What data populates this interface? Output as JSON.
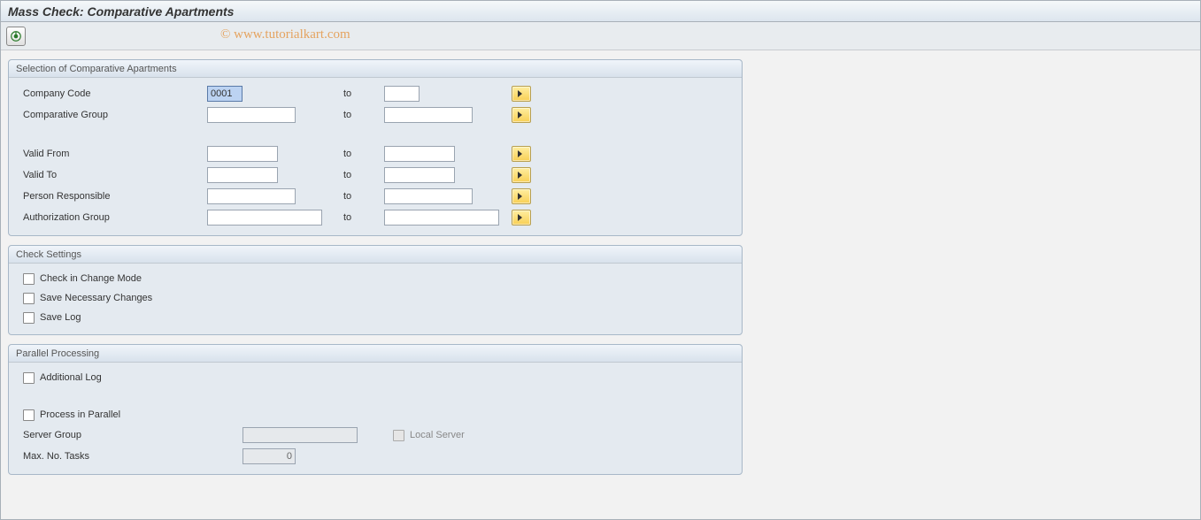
{
  "header": {
    "title": "Mass Check: Comparative Apartments",
    "watermark": "© www.tutorialkart.com"
  },
  "group_selection": {
    "title": "Selection of Comparative Apartments",
    "company_code_label": "Company Code",
    "company_code_from": "0001",
    "company_code_to": "",
    "comparative_group_label": "Comparative Group",
    "comparative_group_from": "",
    "comparative_group_to": "",
    "valid_from_label": "Valid From",
    "valid_from_from": "",
    "valid_from_to": "",
    "valid_to_label": "Valid To",
    "valid_to_from": "",
    "valid_to_to": "",
    "person_resp_label": "Person Responsible",
    "person_resp_from": "",
    "person_resp_to": "",
    "auth_group_label": "Authorization Group",
    "auth_group_from": "",
    "auth_group_to": "",
    "to_label": "to"
  },
  "group_check": {
    "title": "Check Settings",
    "check_change_mode": "Check in Change Mode",
    "save_changes": "Save Necessary Changes",
    "save_log": "Save Log"
  },
  "group_parallel": {
    "title": "Parallel Processing",
    "additional_log": "Additional Log",
    "process_parallel": "Process in Parallel",
    "server_group_label": "Server Group",
    "server_group_value": "",
    "local_server": "Local Server",
    "max_tasks_label": "Max. No. Tasks",
    "max_tasks_value": "0"
  }
}
